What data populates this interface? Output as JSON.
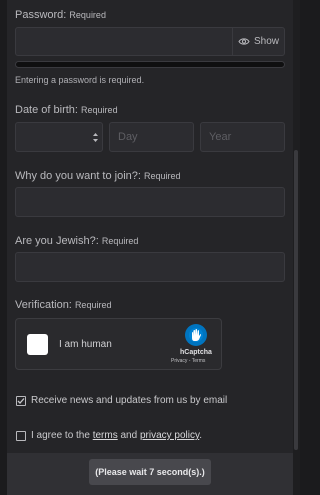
{
  "password": {
    "label": "Password:",
    "required": "Required",
    "show_label": "Show",
    "hint": "Entering a password is required.",
    "show_icon": "eye-icon"
  },
  "dob": {
    "label": "Date of birth:",
    "required": "Required",
    "day_placeholder": "Day",
    "year_placeholder": "Year",
    "month_icon": "up-down-chevron-icon"
  },
  "why_join": {
    "label": "Why do you want to join?:",
    "required": "Required"
  },
  "jewish": {
    "label": "Are you Jewish?:",
    "required": "Required"
  },
  "verification": {
    "label": "Verification:",
    "required": "Required",
    "captcha_text": "I am human",
    "captcha_brand": "hCaptcha",
    "captcha_links": "Privacy - Terms",
    "captcha_icon": "hcaptcha-logo"
  },
  "newsletter": {
    "label": "Receive news and updates from us by email",
    "checked": true
  },
  "terms": {
    "prefix": "I agree to the ",
    "terms_link": "terms",
    "and": " and ",
    "privacy_link": "privacy policy",
    "suffix": ".",
    "checked": false
  },
  "submit": {
    "label": "(Please wait 7 second(s).)"
  },
  "colors": {
    "background": "#1b1b1d",
    "panel": "#252528",
    "input": "#2c2c30",
    "hcaptcha_accent": "#0074bf"
  }
}
